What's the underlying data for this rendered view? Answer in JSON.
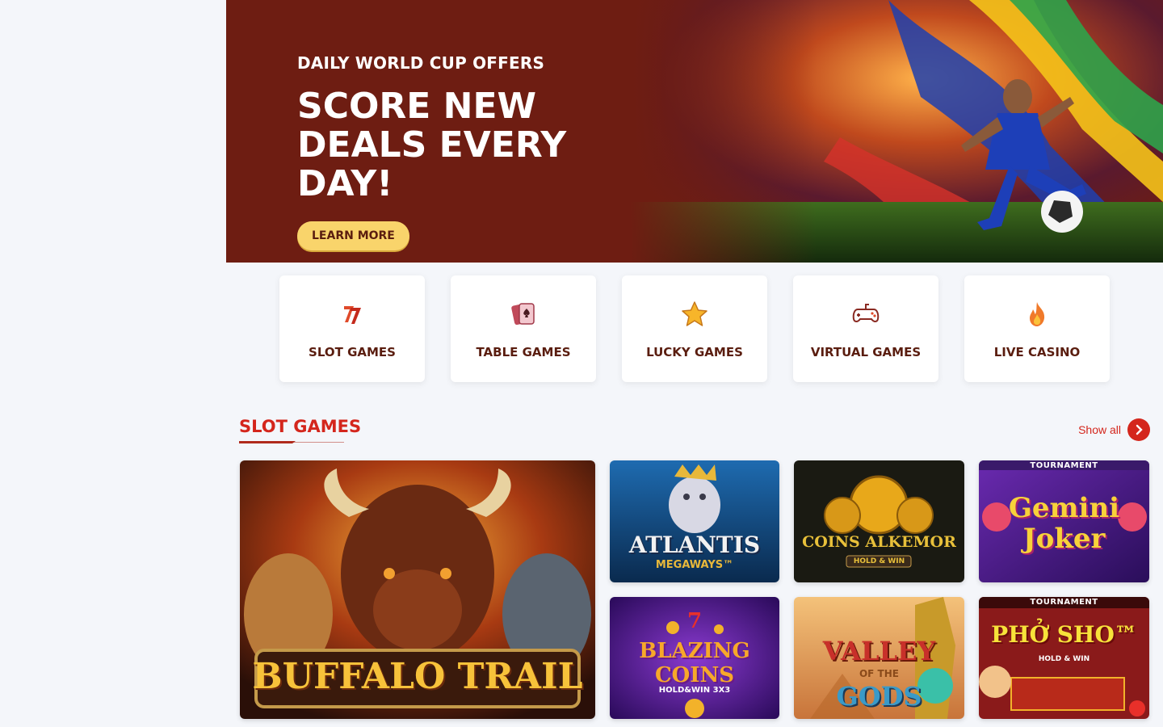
{
  "hero": {
    "kicker": "DAILY WORLD CUP OFFERS",
    "title": "SCORE NEW DEALS EVERY DAY!",
    "button": "LEARN MORE"
  },
  "categories": [
    {
      "label": "SLOT GAMES",
      "icon": "slot-sevens-icon"
    },
    {
      "label": "TABLE GAMES",
      "icon": "playing-cards-icon"
    },
    {
      "label": "LUCKY GAMES",
      "icon": "star-icon"
    },
    {
      "label": "VIRTUAL GAMES",
      "icon": "gamepad-icon"
    },
    {
      "label": "LIVE CASINO",
      "icon": "flame-icon"
    }
  ],
  "slots": {
    "title": "SLOT GAMES",
    "show_all": "Show all",
    "games": [
      {
        "name": "BUFFALO TRAIL"
      },
      {
        "name": "ATLANTIS",
        "sub": "MEGAWAYS™"
      },
      {
        "name": "COINS ALKEMOR",
        "sub": "HOLD & WIN"
      },
      {
        "name": "Gemini Joker",
        "ribbon": "TOURNAMENT"
      },
      {
        "name": "BLAZING COINS",
        "sub": "HOLD&WIN 3X3"
      },
      {
        "name": "VALLEY",
        "sub": "OF THE",
        "name2": "GODS"
      },
      {
        "name": "PHỞ SHO™",
        "sub": "HOLD & WIN",
        "ribbon": "TOURNAMENT"
      }
    ]
  },
  "colors": {
    "hero_bg": "#6e1d12",
    "accent": "#d4261c",
    "button": "#f9d46b"
  }
}
